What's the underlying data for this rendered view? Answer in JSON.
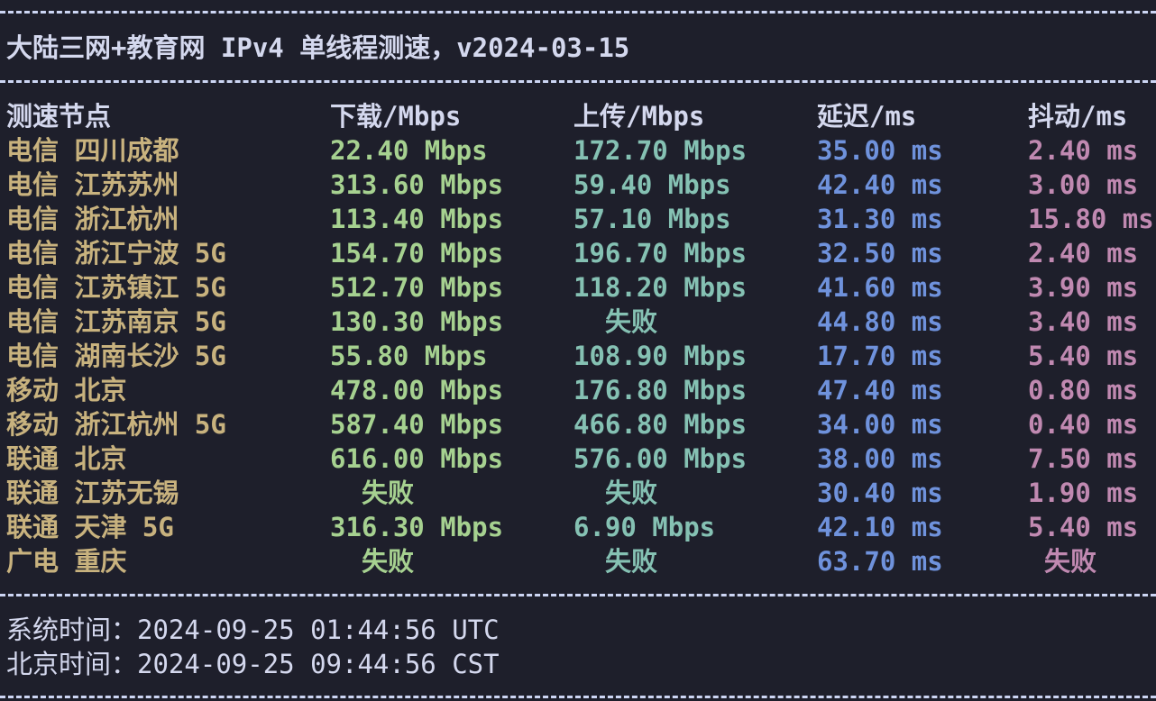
{
  "title": "大陆三网+教育网 IPv4 单线程测速，v2024-03-15",
  "headers": {
    "node": "测速节点",
    "download": "下载/Mbps",
    "upload": "上传/Mbps",
    "latency": "延迟/ms",
    "jitter": "抖动/ms"
  },
  "rows": [
    {
      "node": "电信 四川成都",
      "download": "22.40 Mbps",
      "upload": "172.70 Mbps",
      "latency": "35.00 ms",
      "jitter": "2.40 ms"
    },
    {
      "node": "电信 江苏苏州",
      "download": "313.60 Mbps",
      "upload": "59.40 Mbps",
      "latency": "42.40 ms",
      "jitter": "3.00 ms"
    },
    {
      "node": "电信 浙江杭州",
      "download": "113.40 Mbps",
      "upload": "57.10 Mbps",
      "latency": "31.30 ms",
      "jitter": "15.80 ms"
    },
    {
      "node": "电信 浙江宁波 5G",
      "download": "154.70 Mbps",
      "upload": "196.70 Mbps",
      "latency": "32.50 ms",
      "jitter": "2.40 ms"
    },
    {
      "node": "电信 江苏镇江 5G",
      "download": "512.70 Mbps",
      "upload": "118.20 Mbps",
      "latency": "41.60 ms",
      "jitter": "3.90 ms"
    },
    {
      "node": "电信 江苏南京 5G",
      "download": "130.30 Mbps",
      "upload": "失败",
      "latency": "44.80 ms",
      "jitter": "3.40 ms"
    },
    {
      "node": "电信 湖南长沙 5G",
      "download": "55.80 Mbps",
      "upload": "108.90 Mbps",
      "latency": "17.70 ms",
      "jitter": "5.40 ms"
    },
    {
      "node": "移动 北京",
      "download": "478.00 Mbps",
      "upload": "176.80 Mbps",
      "latency": "47.40 ms",
      "jitter": "0.80 ms"
    },
    {
      "node": "移动 浙江杭州 5G",
      "download": "587.40 Mbps",
      "upload": "466.80 Mbps",
      "latency": "34.00 ms",
      "jitter": "0.40 ms"
    },
    {
      "node": "联通 北京",
      "download": "616.00 Mbps",
      "upload": "576.00 Mbps",
      "latency": "38.00 ms",
      "jitter": "7.50 ms"
    },
    {
      "node": "联通 江苏无锡",
      "download": "失败",
      "upload": "失败",
      "latency": "30.40 ms",
      "jitter": "1.90 ms"
    },
    {
      "node": "联通 天津 5G",
      "download": "316.30 Mbps",
      "upload": "6.90 Mbps",
      "latency": "42.10 ms",
      "jitter": "5.40 ms"
    },
    {
      "node": "广电 重庆",
      "download": "失败",
      "upload": "失败",
      "latency": "63.70 ms",
      "jitter": "失败"
    }
  ],
  "footer": {
    "system_time_label": "系统时间：",
    "system_time": "2024-09-25 01:44:56 UTC",
    "beijing_time_label": "北京时间：",
    "beijing_time": "2024-09-25 09:44:56 CST"
  },
  "colors": {
    "background": "#1e1f2b",
    "node": "#c8b27e",
    "download": "#a6d190",
    "upload": "#85c1b3",
    "latency": "#6f92dc",
    "jitter": "#c089b1"
  }
}
